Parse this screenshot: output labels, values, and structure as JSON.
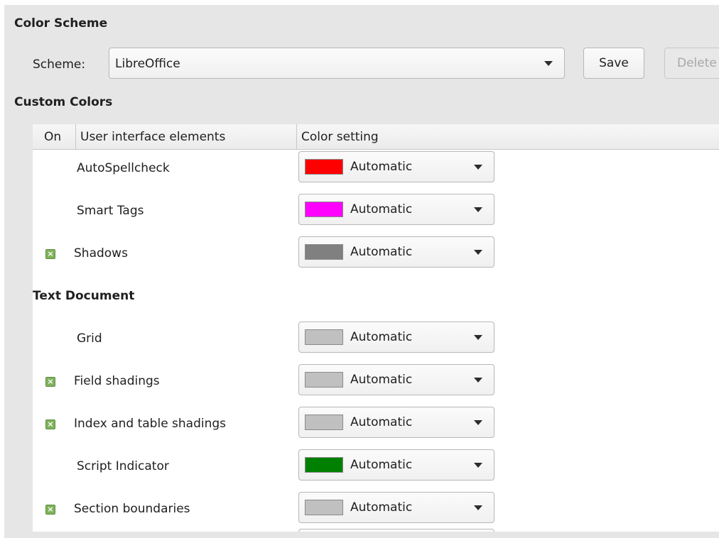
{
  "color_scheme": {
    "title": "Color Scheme",
    "scheme_label": "Scheme:",
    "scheme_value": "LibreOffice",
    "save_label": "Save",
    "delete_label": "Delete"
  },
  "custom_colors": {
    "title": "Custom Colors",
    "columns": {
      "on": "On",
      "ui_elements": "User interface elements",
      "color_setting": "Color setting"
    },
    "rows": [
      {
        "label": "AutoSpellcheck",
        "checked": false,
        "color": "#ff0000",
        "setting": "Automatic"
      },
      {
        "label": "Smart Tags",
        "checked": false,
        "color": "#ff00ff",
        "setting": "Automatic"
      },
      {
        "label": "Shadows",
        "checked": true,
        "color": "#808080",
        "setting": "Automatic"
      },
      {
        "group": "Text Document"
      },
      {
        "label": "Grid",
        "checked": false,
        "color": "#c0c0c0",
        "setting": "Automatic"
      },
      {
        "label": "Field shadings",
        "checked": true,
        "color": "#c0c0c0",
        "setting": "Automatic"
      },
      {
        "label": "Index and table shadings",
        "checked": true,
        "color": "#c0c0c0",
        "setting": "Automatic"
      },
      {
        "label": "Script Indicator",
        "checked": false,
        "color": "#008000",
        "setting": "Automatic"
      },
      {
        "label": "Section boundaries",
        "checked": true,
        "color": "#c0c0c0",
        "setting": "Automatic"
      }
    ]
  },
  "icons": {
    "checkbox_checked": "checkbox-checked-icon",
    "dropdown_arrow": "chevron-down-icon"
  }
}
